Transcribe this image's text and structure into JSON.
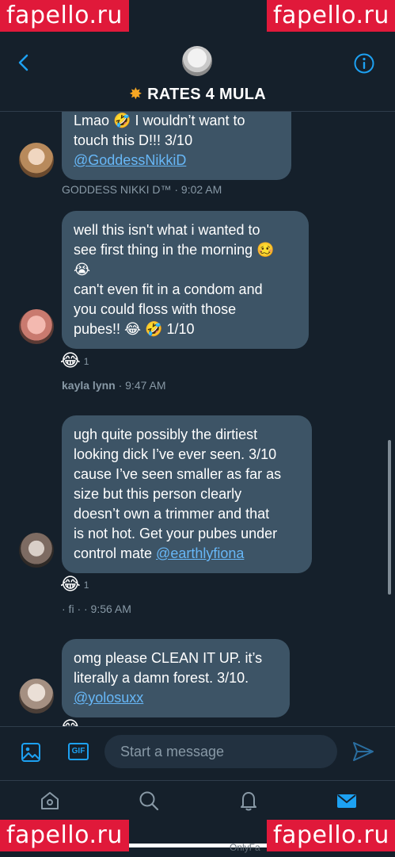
{
  "watermarks": [
    "fapello.ru",
    "fapello.ru",
    "fapello.ru",
    "fapello.ru"
  ],
  "header": {
    "title_icon": "collision-icon",
    "title": "RATES 4 MULA"
  },
  "messages": [
    {
      "text_before": "Lmao 🤣   I wouldn’t want to\ntouch this D!!!  3/10\n",
      "mention": "@GoddessNikkiD",
      "sender": "GODDESS NIKKI D™",
      "time": "· 9:02 AM"
    },
    {
      "text_before": "well this isn't what i wanted to\nsee first thing in the morning 🥴\n😭\ncan't even fit in a condom and\nyou could floss with those\npubes!! 😂 🤣  1/10",
      "reaction": "😂",
      "reaction_count": "1",
      "sender": "kayla lynn",
      "time": "· 9:47 AM"
    },
    {
      "text_before": "ugh quite possibly the dirtiest\nlooking dick I’ve ever seen. 3/10\ncause I’ve seen smaller as far as\nsize but this person clearly\ndoesn’t own a trimmer and that\nis not hot. Get your pubes under\ncontrol mate ",
      "mention": "@earthlyfiona",
      "reaction": "😂",
      "reaction_count": "1",
      "sender": "· fi  ·",
      "time": "· 9:56 AM"
    },
    {
      "text_before": "omg please CLEAN IT UP. it’s\nliterally a damn forest. 3/10.\n",
      "mention": "@yolosuxx",
      "reaction": "😂"
    }
  ],
  "composer": {
    "placeholder": "Start a message",
    "gif_label": "GIF"
  },
  "tabs": [
    "home-icon",
    "search-icon",
    "notifications-icon",
    "messages-icon"
  ],
  "footer": "OnlyFa",
  "colors": {
    "background": "#15202b",
    "bubble": "#3d5466",
    "accent": "#1da1f2",
    "mention": "#67b7f7"
  }
}
